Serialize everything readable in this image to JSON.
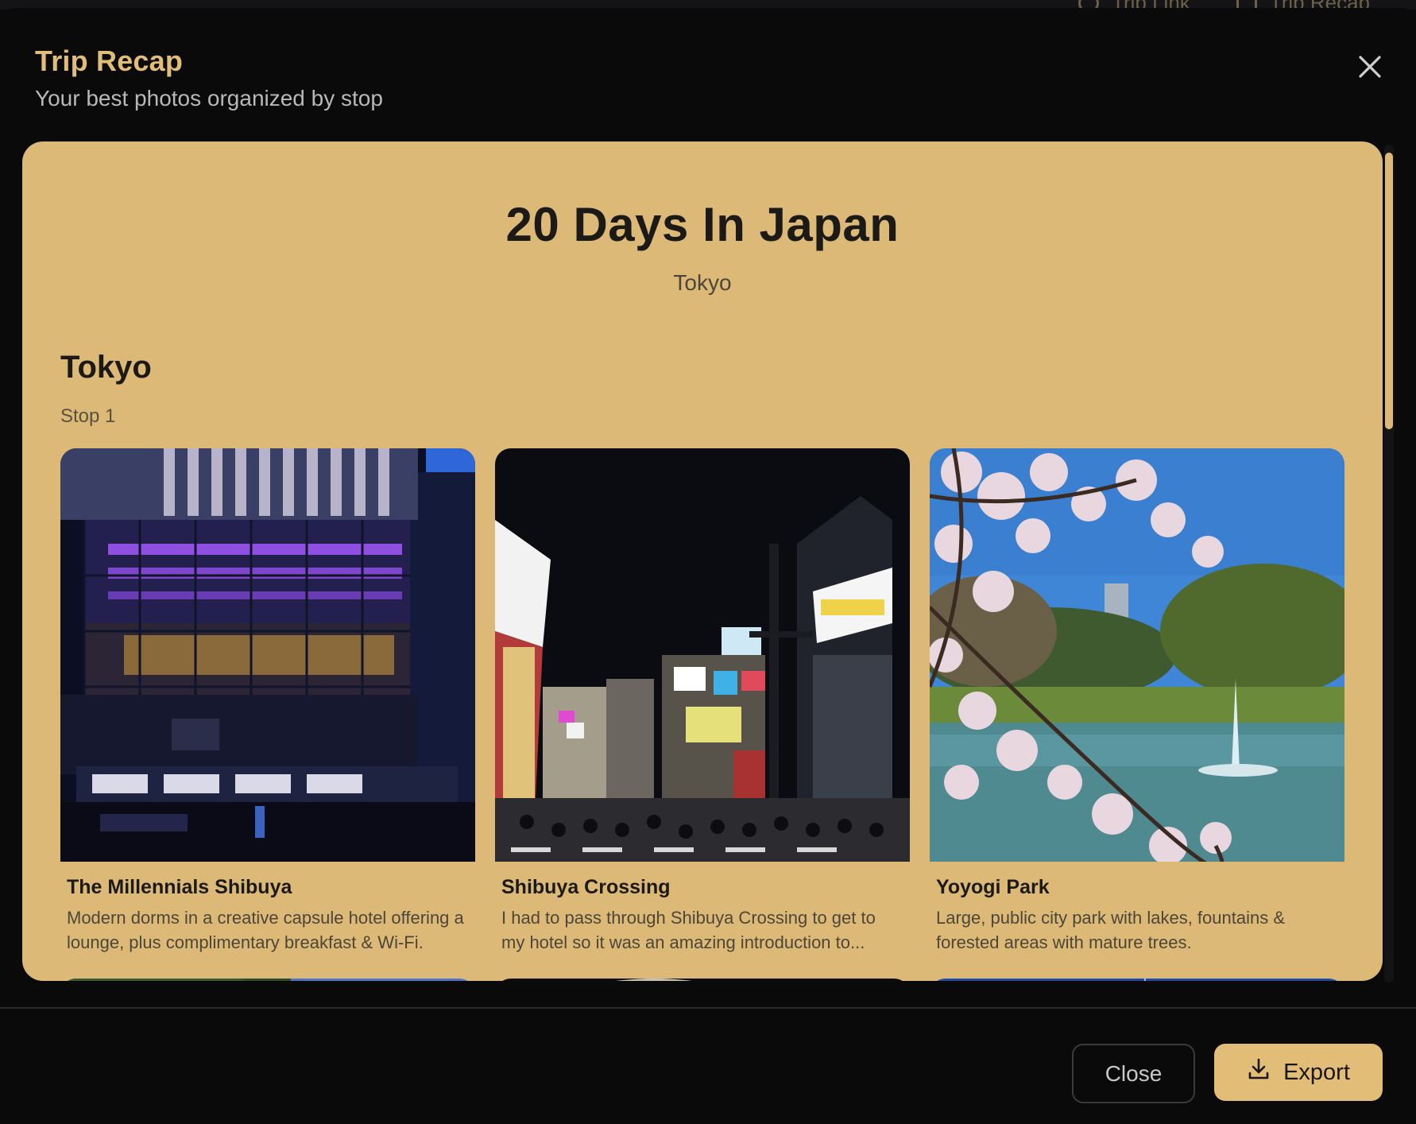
{
  "background_tabs": [
    {
      "label": "Trip Link",
      "icon": "link-icon"
    },
    {
      "label": "Trip Recap",
      "icon": "recap-icon"
    }
  ],
  "modal": {
    "title": "Trip Recap",
    "subtitle": "Your best photos organized by stop"
  },
  "recap": {
    "trip_title": "20 Days In Japan",
    "destination": "Tokyo"
  },
  "stop": {
    "name": "Tokyo",
    "label": "Stop 1"
  },
  "cards": [
    {
      "title": "The Millennials Shibuya",
      "description": "Modern dorms in a creative capsule hotel offering a lounge, plus complimentary breakfast & Wi-Fi."
    },
    {
      "title": "Shibuya Crossing",
      "description": "I had to pass through Shibuya Crossing to get to my hotel so it was an amazing introduction to..."
    },
    {
      "title": "Yoyogi Park",
      "description": "Large, public city park with lakes, fountains & forested areas with mature trees."
    }
  ],
  "footer": {
    "close_label": "Close",
    "export_label": "Export"
  },
  "colors": {
    "accent": "#e2bd77",
    "card_background": "#ddb978",
    "modal_background": "#0a0a0b"
  }
}
